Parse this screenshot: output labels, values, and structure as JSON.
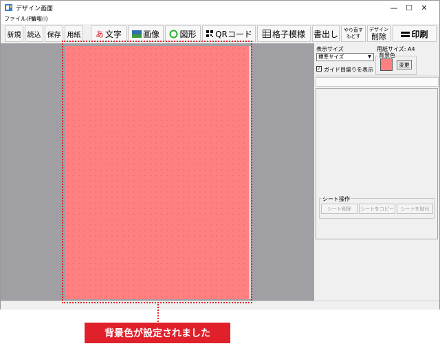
{
  "window": {
    "title": "デザイン画面",
    "controls": {
      "minimize": "—",
      "maximize": "☐",
      "close": "✕"
    }
  },
  "menu": {
    "file": "ファイル(F)",
    "info": "情報(I)"
  },
  "toolbar": {
    "new": "新規",
    "open": "読込",
    "save": "保存",
    "paper": "用紙",
    "text_icon": "あ",
    "text": "文字",
    "image": "画像",
    "shape": "図形",
    "qr": "QRコード",
    "grid": "格子模様",
    "export": "書出し",
    "redo": "やり直す",
    "undo": "もどす",
    "design_sub": "デザイン",
    "delete": "削除",
    "print": "印刷"
  },
  "panel": {
    "display_size_label": "表示サイズ",
    "display_size_value": "標準サイズ",
    "paper_size_label": "用紙サイズ: A4",
    "bg_color_label": "背景色",
    "change_button": "変更",
    "show_guides": "ガイド目盛りを表示",
    "sheet_ops_label": "シート操作",
    "sheet_delete": "シート削除",
    "sheet_copy": "シートをコピー",
    "sheet_paste": "シートを貼付"
  },
  "colors": {
    "background_color": "#ff8080",
    "accent": "#e0202a"
  },
  "callout": {
    "text": "背景色が設定されました"
  }
}
